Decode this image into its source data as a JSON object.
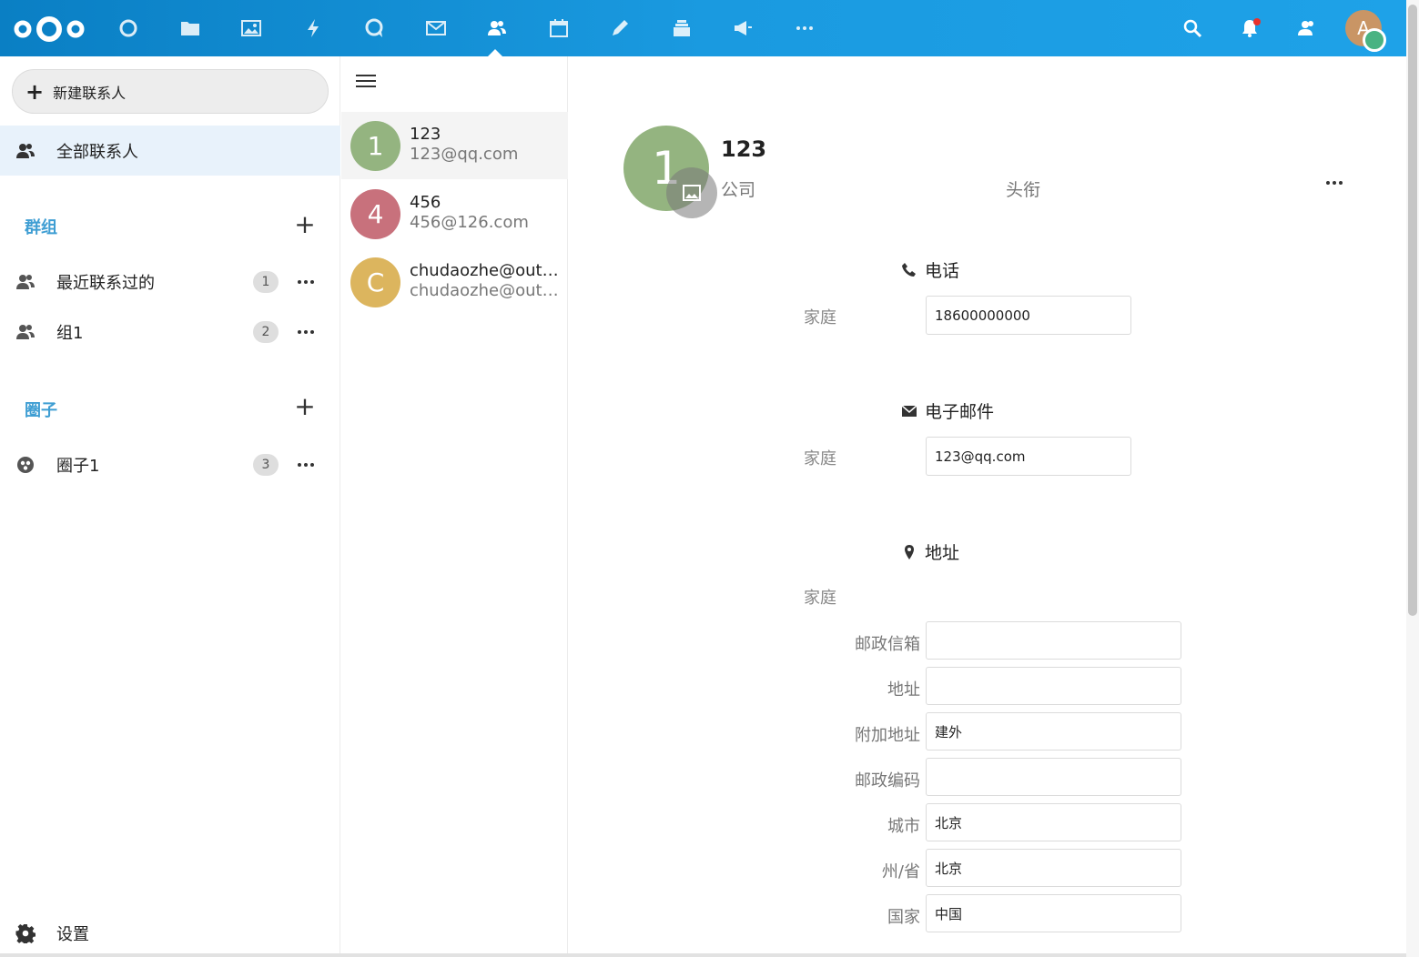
{
  "header": {
    "apps": [
      "dashboard",
      "files",
      "photos",
      "activity",
      "talk",
      "mail",
      "contacts",
      "calendar",
      "notes",
      "deck",
      "announcements",
      "more"
    ],
    "active_app": "contacts",
    "user_initial": "A"
  },
  "nav": {
    "new_contact_label": "新建联系人",
    "all_contacts_label": "全部联系人",
    "groups_caption": "群组",
    "groups": [
      {
        "label": "最近联系过的",
        "count": "1"
      },
      {
        "label": "组1",
        "count": "2"
      }
    ],
    "circles_caption": "圈子",
    "circles": [
      {
        "label": "圈子1",
        "count": "3"
      }
    ],
    "settings_label": "设置"
  },
  "contacts": [
    {
      "initial": "1",
      "name": "123",
      "email": "123@qq.com",
      "color": "#94b480"
    },
    {
      "initial": "4",
      "name": "456",
      "email": "456@126.com",
      "color": "#c8717c"
    },
    {
      "initial": "C",
      "name": "chudaozhe@outl...",
      "email": "chudaozhe@outl...",
      "color": "#dcb55e"
    }
  ],
  "details": {
    "avatar_initial": "1",
    "name": "123",
    "company_placeholder": "公司",
    "title_placeholder": "头衔",
    "phone": {
      "heading": "电话",
      "type": "家庭",
      "value": "18600000000"
    },
    "email": {
      "heading": "电子邮件",
      "type": "家庭",
      "value": "123@qq.com"
    },
    "address": {
      "heading": "地址",
      "type": "家庭",
      "fields": [
        {
          "label": "邮政信箱",
          "value": ""
        },
        {
          "label": "地址",
          "value": ""
        },
        {
          "label": "附加地址",
          "value": "建外"
        },
        {
          "label": "邮政编码",
          "value": ""
        },
        {
          "label": "城市",
          "value": "北京"
        },
        {
          "label": "州/省",
          "value": "北京"
        },
        {
          "label": "国家",
          "value": "中国"
        }
      ]
    }
  },
  "colors": {
    "header": "#0a7fc4",
    "accent": "#3f9ed3",
    "active_bg": "#e8f2fb"
  }
}
